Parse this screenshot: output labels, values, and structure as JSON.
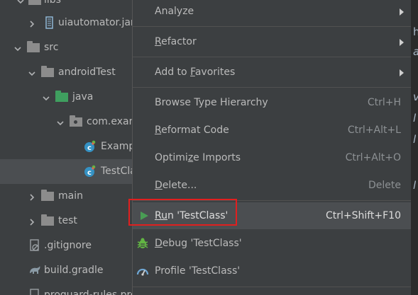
{
  "tree": {
    "items": [
      {
        "label": "libs"
      },
      {
        "label": "uiautomator.jar"
      },
      {
        "label": "src"
      },
      {
        "label": "androidTest"
      },
      {
        "label": "java"
      },
      {
        "label": "com.exam"
      },
      {
        "label": "Examp"
      },
      {
        "label": "TestCla"
      },
      {
        "label": "main"
      },
      {
        "label": "test"
      },
      {
        "label": ".gitignore"
      },
      {
        "label": "build.gradle"
      },
      {
        "label": "proguard-rules.pro"
      }
    ]
  },
  "menu": {
    "analyze": {
      "label": "Analyze"
    },
    "refactor": {
      "label": "Refactor",
      "underline": "R",
      "rest": "efactor"
    },
    "favorites": {
      "pre": "Add to ",
      "underline": "F",
      "rest": "avorites"
    },
    "hierarchy": {
      "label": "Browse Type Hierarchy",
      "shortcut": "Ctrl+H"
    },
    "reformat": {
      "underline": "R",
      "rest": "eformat Code",
      "shortcut": "Ctrl+Alt+L"
    },
    "optimize": {
      "pre": "Optimi",
      "underline": "z",
      "rest": "e Imports",
      "shortcut": "Ctrl+Alt+O"
    },
    "delete": {
      "underline": "D",
      "rest": "elete...",
      "shortcut": "Delete"
    },
    "run": {
      "underline": "Ru",
      "rest": "n 'TestClass'",
      "shortcut": "Ctrl+Shift+F10"
    },
    "debug": {
      "underline": "D",
      "rest": "ebug 'TestClass'"
    },
    "profile": {
      "label": "Profile 'TestClass'"
    }
  },
  "editor": {
    "fragments": [
      "h",
      "a",
      "v",
      "l",
      "l",
      "l"
    ]
  },
  "colors": {
    "highlight_border": "#e01f1f",
    "run_green": "#499c54",
    "debug_green": "#62b543",
    "folder_gray": "#8c8c8c",
    "source_folder_green": "#3f9f5f",
    "class_blue": "#3592c4"
  }
}
